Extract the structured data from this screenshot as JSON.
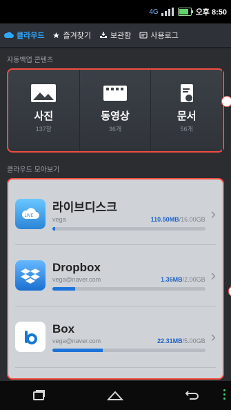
{
  "statusbar": {
    "network": "4G",
    "time": "오후 8:50"
  },
  "tabs": [
    {
      "label": "클라우드",
      "icon": "cloud-icon",
      "active": true
    },
    {
      "label": "즐겨찾기",
      "icon": "star-icon",
      "active": false
    },
    {
      "label": "보관함",
      "icon": "tray-icon",
      "active": false
    },
    {
      "label": "사용로그",
      "icon": "log-icon",
      "active": false
    }
  ],
  "autobackup": {
    "title": "자동백업 콘텐츠",
    "items": [
      {
        "label": "사진",
        "count": "137장",
        "icon": "photo-icon"
      },
      {
        "label": "동영상",
        "count": "36개",
        "icon": "video-icon"
      },
      {
        "label": "문서",
        "count": "56개",
        "icon": "document-icon"
      }
    ]
  },
  "cloud": {
    "title": "클라우드 모아보기",
    "services": [
      {
        "name": "라이브디스크",
        "account": "vega",
        "used": "110.50MB",
        "total": "/16.00GB",
        "usage_fraction": 0.02
      },
      {
        "name": "Dropbox",
        "account": "vega@naver.com",
        "used": "1.36MB",
        "total": "/2.00GB",
        "usage_fraction": 0.15
      },
      {
        "name": "Box",
        "account": "vega@naver.com",
        "used": "22.31MB",
        "total": "/5.00GB",
        "usage_fraction": 0.33
      }
    ]
  },
  "colors": {
    "accent": "#2ea8ff",
    "highlight": "#f24d3f",
    "progress": "#1d73d9"
  }
}
